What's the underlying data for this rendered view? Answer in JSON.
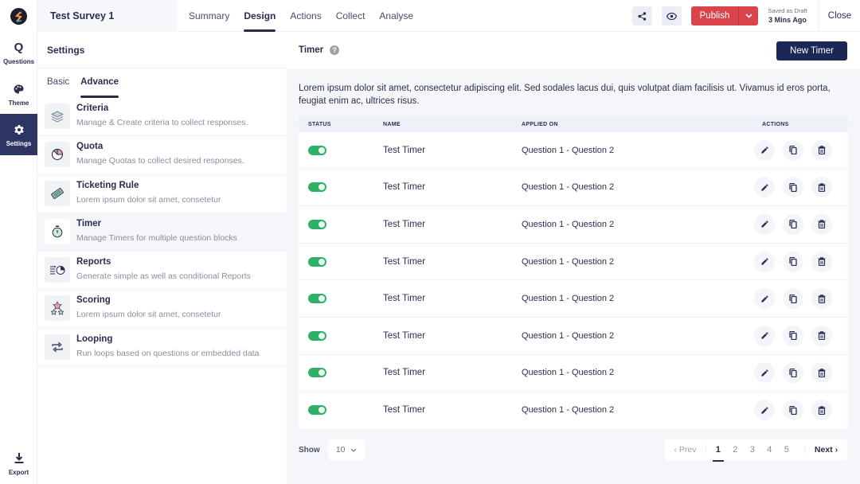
{
  "rail": {
    "logo": "app-logo",
    "items": [
      {
        "label": "Questions",
        "icon": "Q"
      },
      {
        "label": "Theme",
        "icon": "palette-icon"
      },
      {
        "label": "Settings",
        "icon": "gear-icon",
        "active": true
      }
    ],
    "export_label": "Export"
  },
  "header": {
    "survey_title": "Test Survey 1",
    "tabs": [
      {
        "label": "Summary"
      },
      {
        "label": "Design",
        "active": true
      },
      {
        "label": "Actions"
      },
      {
        "label": "Collect"
      },
      {
        "label": "Analyse"
      }
    ],
    "publish_label": "Publish",
    "saved_line1": "Saved as Draft",
    "saved_line2": "3 Mins Ago",
    "close_label": "Close"
  },
  "settings": {
    "title": "Settings",
    "subtabs": [
      {
        "label": "Basic"
      },
      {
        "label": "Advance",
        "active": true
      }
    ],
    "options": [
      {
        "name": "Criteria",
        "desc": "Manage & Create criteria to collect responses.",
        "icon": "layers-icon"
      },
      {
        "name": "Quota",
        "desc": "Manage Quotas to collect desired responses.",
        "icon": "pie-icon"
      },
      {
        "name": "Ticketing Rule",
        "desc": "Lorem ipsum dolor sit amet, consetetur",
        "icon": "ticket-icon"
      },
      {
        "name": "Timer",
        "desc": "Manage Timers for multiple question blocks",
        "icon": "stopwatch-icon",
        "active": true
      },
      {
        "name": "Reports",
        "desc": "Generate simple as well as conditional Reports",
        "icon": "report-icon"
      },
      {
        "name": "Scoring",
        "desc": "Lorem ipsum dolor sit amet, consetetur",
        "icon": "stars-icon"
      },
      {
        "name": "Looping",
        "desc": "Run loops based on questions or embedded data",
        "icon": "loop-icon"
      }
    ]
  },
  "main": {
    "title": "Timer",
    "help": "?",
    "new_button": "New Timer",
    "description": "Lorem ipsum dolor sit amet, consectetur adipiscing elit. Sed sodales lacus dui, quis volutpat diam facilisis ut. Vivamus id eros porta, feugiat enim ac, ultrices risus.",
    "columns": {
      "status": "STATUS",
      "name": "NAME",
      "applied": "APPLIED ON",
      "actions": "ACTIONS"
    },
    "rows": [
      {
        "status": true,
        "name": "Test Timer",
        "applied": "Question 1 - Question 2"
      },
      {
        "status": true,
        "name": "Test Timer",
        "applied": "Question 1 - Question 2"
      },
      {
        "status": true,
        "name": "Test Timer",
        "applied": "Question 1 - Question 2"
      },
      {
        "status": true,
        "name": "Test Timer",
        "applied": "Question 1 - Question 2"
      },
      {
        "status": true,
        "name": "Test Timer",
        "applied": "Question 1 - Question 2"
      },
      {
        "status": true,
        "name": "Test Timer",
        "applied": "Question 1 - Question 2"
      },
      {
        "status": true,
        "name": "Test Timer",
        "applied": "Question 1 - Question 2"
      },
      {
        "status": true,
        "name": "Test Timer",
        "applied": "Question 1 - Question 2"
      }
    ],
    "show_label": "Show",
    "page_size": "10",
    "pagination": {
      "prev": "‹ Prev",
      "next": "Next ›",
      "pages": [
        "1",
        "2",
        "3",
        "4",
        "5"
      ],
      "current": "1"
    }
  },
  "colors": {
    "primary": "#1d2757",
    "publish": "#d9434a",
    "toggle_on": "#2fb067"
  }
}
